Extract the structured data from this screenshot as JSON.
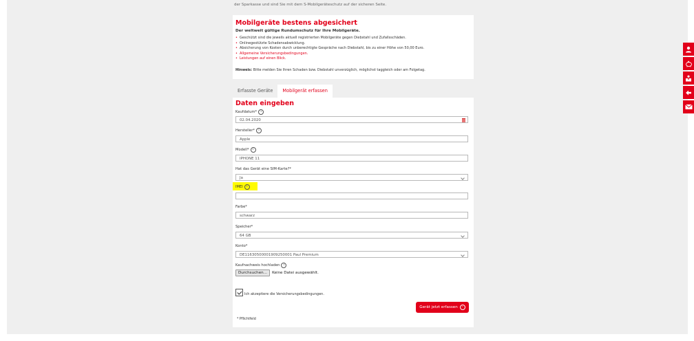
{
  "top_text": "der Sparkasse und sind Sie mit dem S-Mobilgeräteschutz auf der sicheren Seite.",
  "info": {
    "title": "Mobilgeräte bestens abgesichert",
    "subtitle": "Der weltweit gültige Rundumschutz für Ihre Mobilgeräte.",
    "bullets": [
      {
        "text": "Geschützt sind die jeweils aktuell registrierten Mobilgeräte gegen Diebstahl und Zufallsschäden.",
        "link": false
      },
      {
        "text": "Onlinegestützte Schadensabwicklung.",
        "link": false
      },
      {
        "text": "Absicherung von Kosten durch unberechtigte Gespräche nach Diebstahl, bis zu einer Höhe von 50,00 Euro.",
        "link": false
      },
      {
        "text": "Allgemeine Versicherungsbedingungen.",
        "link": true
      },
      {
        "text": "Leistungen auf einen Blick.",
        "link": true
      }
    ],
    "hint_label": "Hinweis:",
    "hint_text": " Bitte melden Sie Ihren Schaden bzw. Diebstahl unverzüglich, möglichst taggleich oder am Folgetag."
  },
  "tabs": [
    {
      "label": "Erfasste Geräte",
      "active": false
    },
    {
      "label": "Mobilgerät erfassen",
      "active": true
    }
  ],
  "form": {
    "heading": "Daten eingeben",
    "purchase_date": {
      "label": "Kaufdatum*",
      "value": "02.04.2020"
    },
    "manufacturer": {
      "label": "Hersteller*",
      "value": "Apple"
    },
    "model": {
      "label": "Modell*",
      "value": "IPHONE 11"
    },
    "sim": {
      "label": "Hat das Gerät eine SIM-Karte?*",
      "value": "Ja"
    },
    "imei": {
      "label": "IMEI",
      "value": ""
    },
    "color": {
      "label": "Farbe*",
      "value": "schwarz"
    },
    "storage": {
      "label": "Speicher*",
      "value": "64 GB"
    },
    "account": {
      "label": "Konto*",
      "value": "DE11630500001909250001 Paul Premium"
    },
    "upload": {
      "label": "Kaufnachweis hochladen",
      "button": "Durchsuchen...",
      "status": "Keine Datei ausgewählt."
    },
    "accept_label": "Ich akzeptiere die Versicherungsbedingungen.",
    "submit_label": "Gerät jetzt erfassen",
    "required_note": "* Pflichtfeld"
  },
  "info_glyph": "i",
  "side_icons": [
    "user-icon",
    "piggy-bank-icon",
    "advisor-icon",
    "back-arrow-icon",
    "mail-icon"
  ],
  "colors": {
    "accent": "#e2001a",
    "highlight": "#fffb00"
  }
}
